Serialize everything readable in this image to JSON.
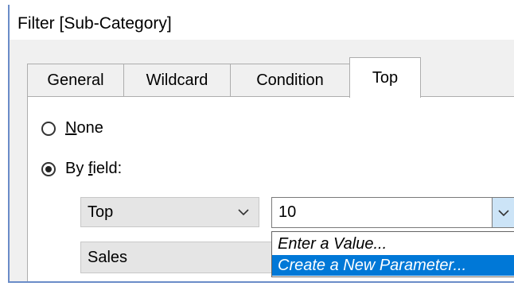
{
  "window": {
    "title": "Filter [Sub-Category]"
  },
  "tabs": [
    {
      "label": "General"
    },
    {
      "label": "Wildcard"
    },
    {
      "label": "Condition"
    },
    {
      "label": "Top",
      "active": true
    }
  ],
  "options": {
    "none": {
      "accesskey": "N",
      "rest": "one",
      "checked": false
    },
    "by_field": {
      "prefix": "By ",
      "accesskey": "f",
      "rest": "ield:",
      "checked": true
    }
  },
  "by_field": {
    "direction_select": {
      "value": "Top"
    },
    "count_combo": {
      "value": "10"
    },
    "field_select": {
      "value": "Sales"
    }
  },
  "count_dropdown": {
    "items": [
      {
        "label": "Enter a Value..."
      },
      {
        "label": "Create a New Parameter...",
        "highlighted": true
      }
    ]
  },
  "colors": {
    "accent": "#0078d7",
    "frame": "#6a8cc8",
    "dropdown_button": "#cce4f7"
  }
}
